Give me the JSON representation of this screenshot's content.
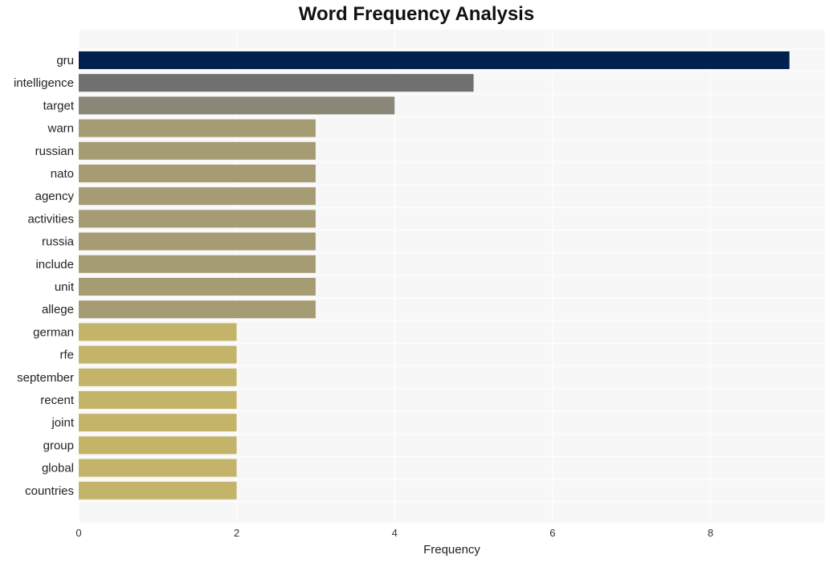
{
  "chart_data": {
    "type": "bar",
    "orientation": "horizontal",
    "title": "Word Frequency Analysis",
    "xlabel": "Frequency",
    "ylabel": "",
    "xlim": [
      0,
      9.45
    ],
    "xticks": [
      0,
      2,
      4,
      6,
      8
    ],
    "grid": true,
    "categories": [
      "gru",
      "intelligence",
      "target",
      "warn",
      "russian",
      "nato",
      "agency",
      "activities",
      "russia",
      "include",
      "unit",
      "allege",
      "german",
      "rfe",
      "september",
      "recent",
      "joint",
      "group",
      "global",
      "countries"
    ],
    "values": [
      9,
      5,
      4,
      3,
      3,
      3,
      3,
      3,
      3,
      3,
      3,
      3,
      2,
      2,
      2,
      2,
      2,
      2,
      2,
      2
    ],
    "colors": [
      "#00214d",
      "#707070",
      "#8a8778",
      "#a59c73",
      "#a59c73",
      "#a59c73",
      "#a59c73",
      "#a59c73",
      "#a59c73",
      "#a59c73",
      "#a59c73",
      "#a59c73",
      "#c4b46a",
      "#c4b46a",
      "#c4b46a",
      "#c4b46a",
      "#c4b46a",
      "#c4b46a",
      "#c4b46a",
      "#c4b46a"
    ],
    "background": "#f7f7f7"
  }
}
